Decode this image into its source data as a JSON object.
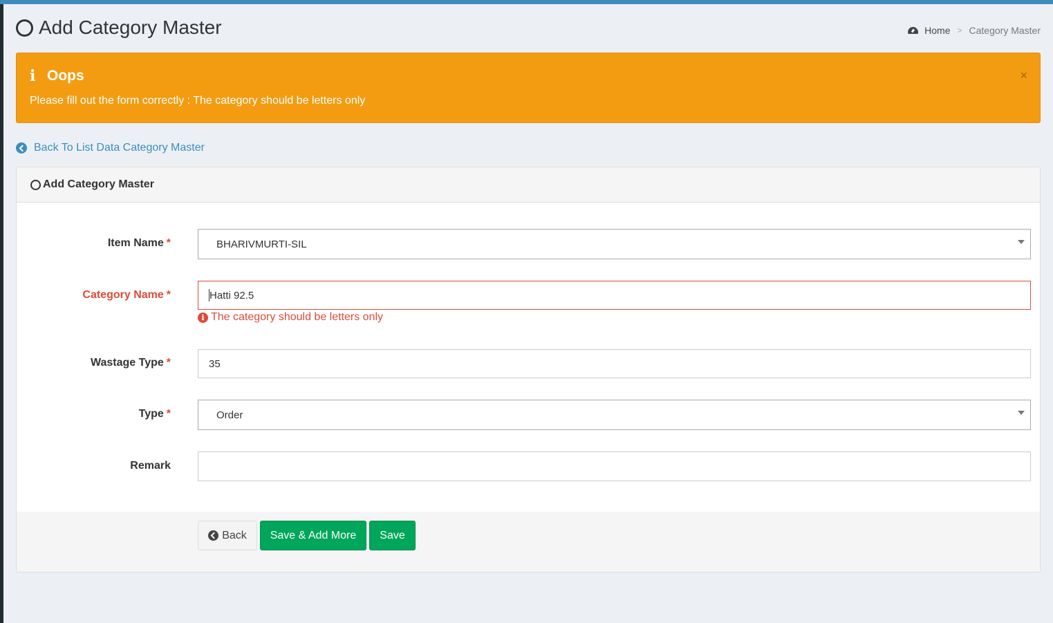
{
  "header": {
    "title": "Add Category Master",
    "breadcrumb": {
      "home": "Home",
      "separator": ">",
      "current": "Category Master"
    }
  },
  "alert": {
    "title": "Oops",
    "message": "Please fill out the form correctly : The category should be letters only",
    "close_glyph": "×",
    "color": "#f39c12"
  },
  "back_link": "Back To List Data Category Master",
  "panel": {
    "title": "Add Category Master",
    "required_marker": "*",
    "fields": {
      "item_name": {
        "label": "Item Name",
        "value": "BHARIVMURTI-SIL"
      },
      "category_name": {
        "label": "Category Name",
        "value": "Hatti 92.5",
        "error": "The category should be letters only"
      },
      "wastage_type": {
        "label": "Wastage Type",
        "value": "35"
      },
      "type": {
        "label": "Type",
        "value": "Order"
      },
      "remark": {
        "label": "Remark",
        "value": ""
      }
    },
    "buttons": {
      "back": "Back",
      "save_add_more": "Save & Add More",
      "save": "Save"
    }
  },
  "colors": {
    "primary": "#3c8dbc",
    "success": "#00a65a",
    "danger": "#dd4b39",
    "warning": "#f39c12"
  },
  "icons": {
    "title": "circle-outline-icon",
    "breadcrumb_home": "dashboard-icon",
    "alert": "info-icon",
    "back_link": "circle-arrow-left-icon",
    "error": "exclamation-circle-icon",
    "back_button": "circle-arrow-left-icon"
  }
}
